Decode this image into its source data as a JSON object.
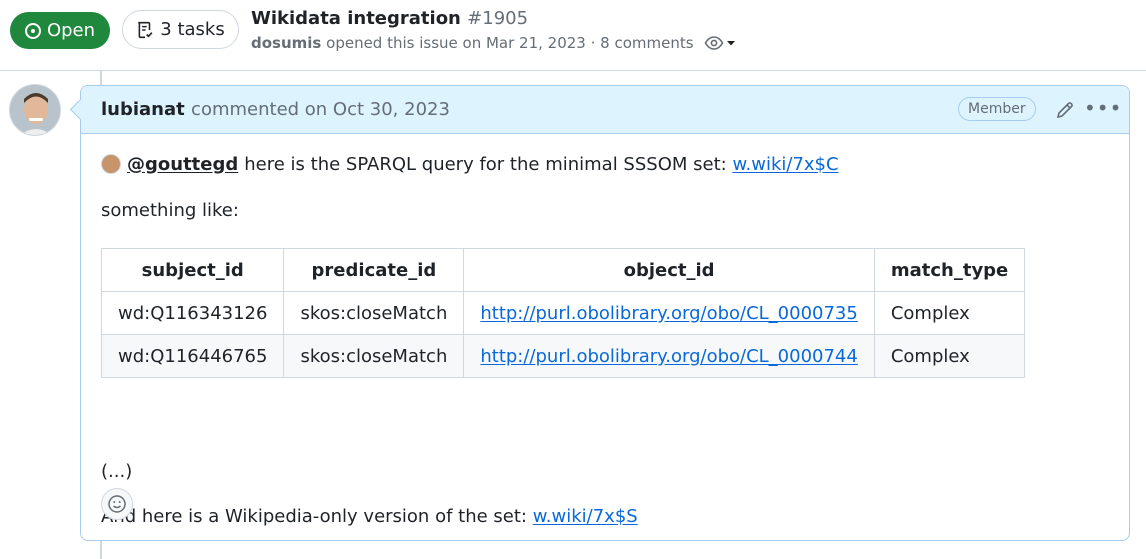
{
  "issue": {
    "state": "Open",
    "tasks_label": "3 tasks",
    "title": "Wikidata integration",
    "number": "#1905",
    "opener": "dosumis",
    "opened_text": "opened this issue on Mar 21, 2023 · 8 comments"
  },
  "comment": {
    "author": "lubianat",
    "when": "commented on Oct 30, 2023",
    "role_badge": "Member",
    "mention": "@gouttegd",
    "line1_text": "here is the SPARQL query for the minimal SSSOM set:",
    "line1_link": "w.wiki/7x$C",
    "line2": "something like:",
    "table": {
      "headers": [
        "subject_id",
        "predicate_id",
        "object_id",
        "match_type"
      ],
      "rows": [
        [
          "wd:Q116343126",
          "skos:closeMatch",
          "http://purl.obolibrary.org/obo/CL_0000735",
          "Complex"
        ],
        [
          "wd:Q116446765",
          "skos:closeMatch",
          "http://purl.obolibrary.org/obo/CL_0000744",
          "Complex"
        ]
      ]
    },
    "ellipsis": "(...)",
    "line4_text": "And here is a Wikipedia-only version of the set:",
    "line4_link": "w.wiki/7x$S"
  },
  "colors": {
    "open_green": "#1f883d",
    "comment_header_bg": "#ddf4ff",
    "link_blue": "#0969da"
  }
}
